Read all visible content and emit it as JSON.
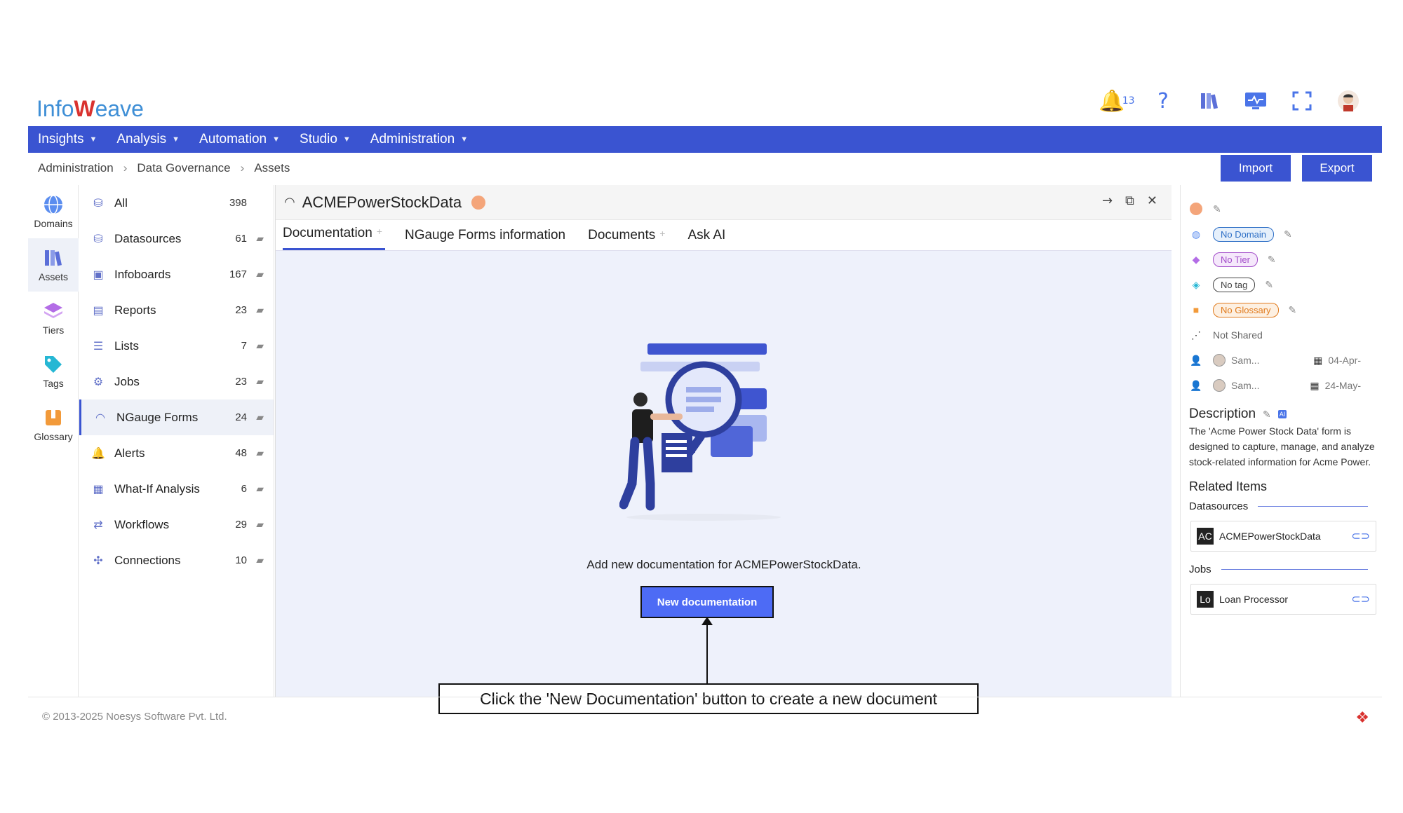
{
  "brand": {
    "name_left": "Info",
    "name_mark": "W",
    "name_right": "eave"
  },
  "header": {
    "bell_count": "13"
  },
  "menu": [
    {
      "label": "Insights"
    },
    {
      "label": "Analysis"
    },
    {
      "label": "Automation"
    },
    {
      "label": "Studio"
    },
    {
      "label": "Administration"
    }
  ],
  "breadcrumb": [
    "Administration",
    "Data Governance",
    "Assets"
  ],
  "actions": {
    "import": "Import",
    "export": "Export"
  },
  "rail": [
    {
      "label": "Domains",
      "icon": "globe-icon",
      "color": "#5b8def"
    },
    {
      "label": "Assets",
      "icon": "books-icon",
      "color": "#5b6fd8"
    },
    {
      "label": "Tiers",
      "icon": "layers-icon",
      "color": "#b36de6"
    },
    {
      "label": "Tags",
      "icon": "tag-icon",
      "color": "#26b7d4"
    },
    {
      "label": "Glossary",
      "icon": "book-icon",
      "color": "#f29a3a"
    }
  ],
  "categories": [
    {
      "label": "All",
      "count": "398"
    },
    {
      "label": "Datasources",
      "count": "61"
    },
    {
      "label": "Infoboards",
      "count": "167"
    },
    {
      "label": "Reports",
      "count": "23"
    },
    {
      "label": "Lists",
      "count": "7"
    },
    {
      "label": "Jobs",
      "count": "23"
    },
    {
      "label": "NGauge Forms",
      "count": "24"
    },
    {
      "label": "Alerts",
      "count": "48"
    },
    {
      "label": "What-If Analysis",
      "count": "6"
    },
    {
      "label": "Workflows",
      "count": "29"
    },
    {
      "label": "Connections",
      "count": "10"
    }
  ],
  "panel": {
    "title": "ACMEPowerStockData",
    "tabs": [
      "Documentation",
      "NGauge Forms information",
      "Documents",
      "Ask AI"
    ],
    "empty_message": "Add new documentation for ACMEPowerStockData.",
    "new_button": "New documentation"
  },
  "callout": "Click the 'New Documentation' button to create a new document",
  "details": {
    "domain": "No Domain",
    "tier": "No Tier",
    "tag": "No tag",
    "glossary": "No Glossary",
    "shared": "Not Shared",
    "created_by": "Sam...",
    "created_date": "04-Apr-",
    "modified_by": "Sam...",
    "modified_date": "24-May-",
    "description_title": "Description",
    "ai_badge": "AI",
    "description": "The 'Acme Power Stock Data' form is designed to capture, manage, and analyze stock-related information for Acme Power.",
    "related_title": "Related Items",
    "datasources_label": "Datasources",
    "datasource_item": {
      "badge": "AC",
      "name": "ACMEPowerStockData"
    },
    "jobs_label": "Jobs",
    "job_item": {
      "badge": "Lo",
      "name": "Loan Processor"
    }
  },
  "footer": {
    "copyright": "© 2013-2025 Noesys Software Pvt. Ltd."
  }
}
